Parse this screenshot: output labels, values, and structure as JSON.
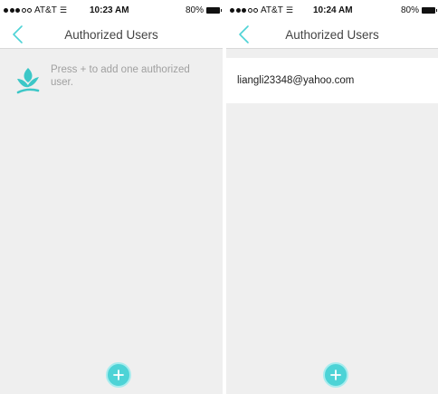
{
  "colors": {
    "accent": "#4dd3d6",
    "leaf": "#3cc7c7",
    "hint_text": "#a0a0a0",
    "background": "#efefef"
  },
  "left": {
    "status": {
      "carrier": "AT&T",
      "time": "10:23 AM",
      "battery": "80%"
    },
    "nav": {
      "back_icon": "chevron-left-icon",
      "title": "Authorized Users"
    },
    "empty_state": {
      "icon": "leaf-icon",
      "text": "Press + to add one authorized user."
    },
    "fab": {
      "icon": "plus-icon"
    }
  },
  "right": {
    "status": {
      "carrier": "AT&T",
      "time": "10:24 AM",
      "battery": "80%"
    },
    "nav": {
      "back_icon": "chevron-left-icon",
      "title": "Authorized Users"
    },
    "users": [
      {
        "email": "liangli23348@yahoo.com"
      }
    ],
    "fab": {
      "icon": "plus-icon"
    }
  }
}
